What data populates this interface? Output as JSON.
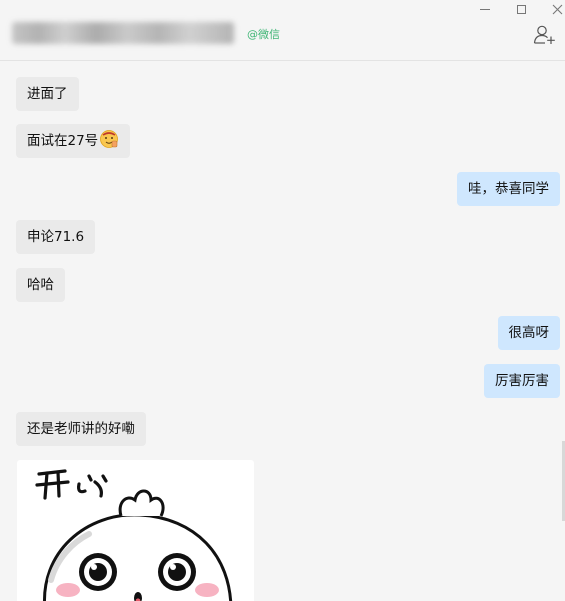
{
  "header": {
    "wechat_tag": "@微信",
    "minimize_label": "—",
    "maximize_label": "☐",
    "close_label": "✕"
  },
  "messages": [
    {
      "side": "incoming",
      "text": "进面了"
    },
    {
      "side": "incoming",
      "text": "面试在27号",
      "emoji": "thumbs-up-face-emoji"
    },
    {
      "side": "outgoing",
      "text": "哇，恭喜同学"
    },
    {
      "side": "incoming",
      "text": "申论71.6"
    },
    {
      "side": "incoming",
      "text": "哈哈"
    },
    {
      "side": "outgoing",
      "text": "很高呀"
    },
    {
      "side": "outgoing",
      "text": "厉害厉害"
    },
    {
      "side": "incoming",
      "text": "还是老师讲的好嘞"
    }
  ],
  "sticker": {
    "caption": "开心",
    "name": "happy-bun-sticker"
  },
  "colors": {
    "incoming_bubble": "#eaeaea",
    "outgoing_bubble": "#cfe7fe",
    "wechat_green": "#3eb575",
    "background": "#f5f5f5"
  }
}
